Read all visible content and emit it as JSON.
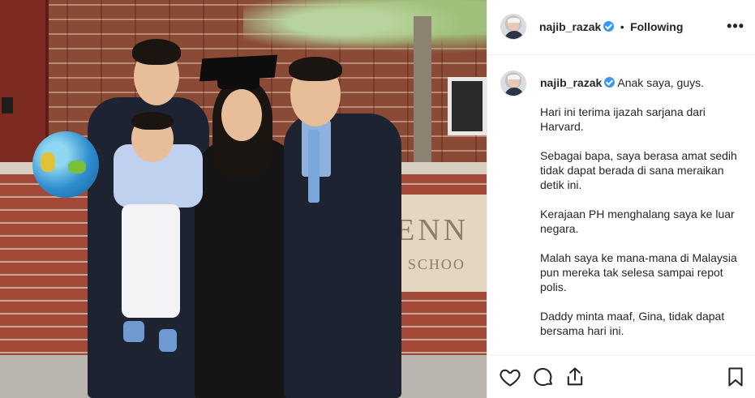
{
  "post": {
    "username": "najib_razak",
    "separator": "•",
    "follow_status": "Following",
    "more_label": "•••",
    "caption": {
      "username": "najib_razak",
      "first_line": "Anak saya, guys.",
      "paragraphs": [
        "Hari ini terima ijazah sarjana dari Harvard.",
        "Sebagai bapa, saya berasa amat sedih tidak dapat berada di sana meraikan detik ini.",
        "Kerajaan PH menghalang saya ke luar negara.",
        "Malah saya ke mana-mana di Malaysia pun mereka tak selesa sampai repot polis.",
        "Daddy minta maaf, Gina, tidak dapat bersama hari ini."
      ]
    },
    "photo_sign": {
      "line1": "ENN",
      "line2": "Y SCHOO"
    },
    "icons": {
      "verified": "verified-badge-icon",
      "like": "heart-icon",
      "comment": "comment-icon",
      "share": "share-icon",
      "save": "bookmark-icon"
    },
    "colors": {
      "verified": "#3897f0",
      "text": "#262626",
      "border": "#efefef"
    }
  }
}
